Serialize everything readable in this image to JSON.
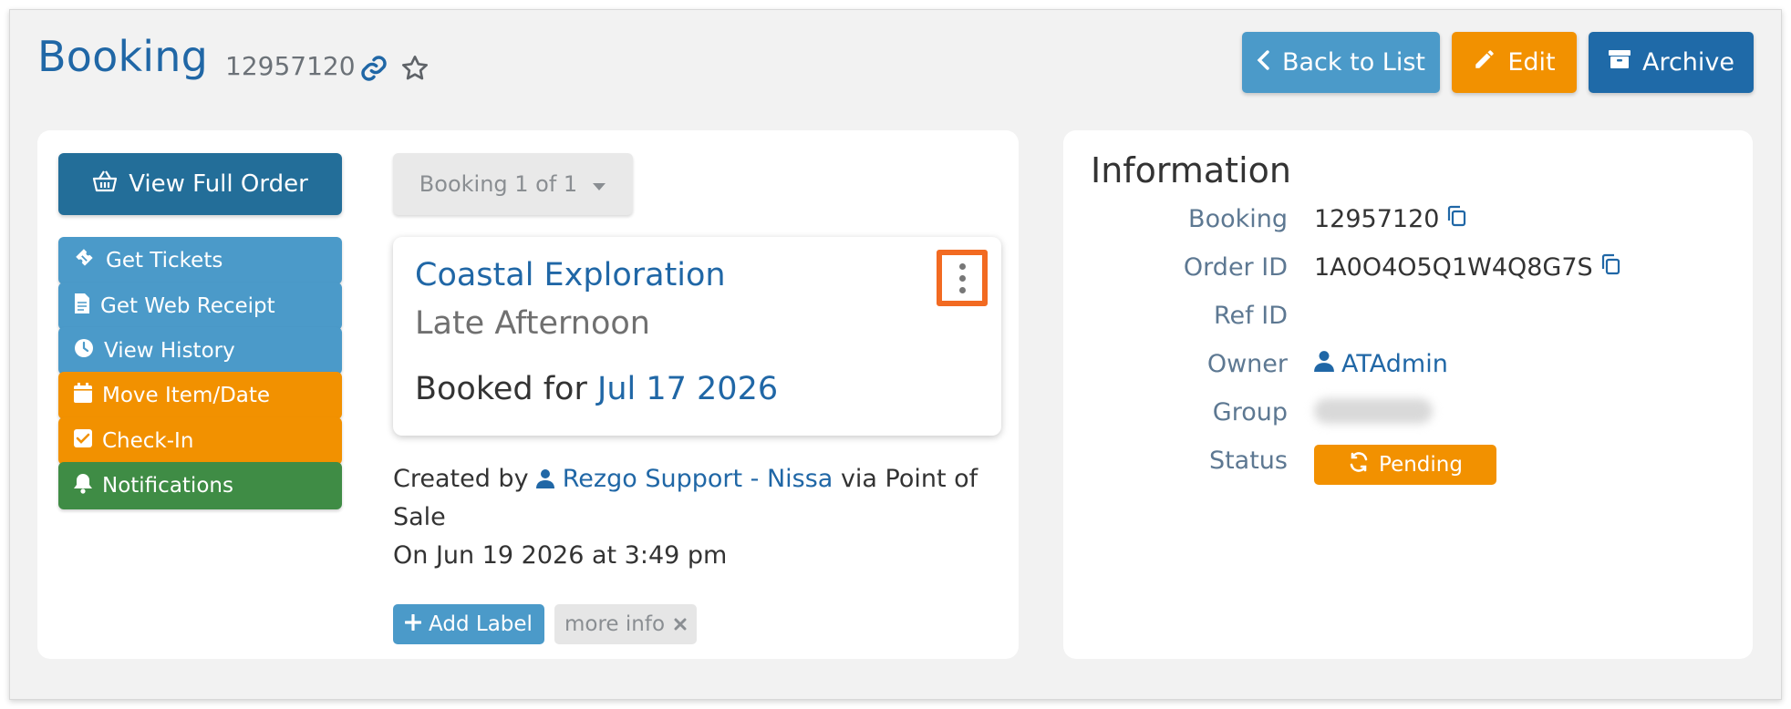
{
  "header": {
    "title": "Booking",
    "booking_number": "12957120",
    "back_label": "Back to List",
    "edit_label": "Edit",
    "archive_label": "Archive"
  },
  "actions": {
    "view_full_order": "View Full Order",
    "items": [
      {
        "label": "Get Tickets",
        "icon": "ticket-icon"
      },
      {
        "label": "Get Web Receipt",
        "icon": "document-icon"
      },
      {
        "label": "View History",
        "icon": "clock-icon"
      },
      {
        "label": "Move Item/Date",
        "icon": "calendar-icon"
      },
      {
        "label": "Check-In",
        "icon": "checkbox-icon"
      },
      {
        "label": "Notifications",
        "icon": "bell-icon"
      }
    ]
  },
  "booking_select": "Booking 1 of 1",
  "item": {
    "name": "Coastal Exploration",
    "time": "Late Afternoon",
    "booked_for_prefix": "Booked for",
    "booked_for_date": "Jul 17 2026"
  },
  "created": {
    "prefix": "Created by",
    "user": "Rezgo Support - Nissa",
    "via": "via Point of Sale",
    "on": "On Jun 19 2026 at 3:49 pm"
  },
  "labels": {
    "add_label": "Add Label",
    "more_info": "more info"
  },
  "information": {
    "title": "Information",
    "rows": [
      {
        "label": "Booking",
        "value": "12957120"
      },
      {
        "label": "Order ID",
        "value": "1A0O4O5Q1W4Q8G7S"
      },
      {
        "label": "Ref ID",
        "value": ""
      },
      {
        "label": "Owner",
        "value": "ATAdmin"
      },
      {
        "label": "Group",
        "value": ""
      },
      {
        "label": "Status",
        "value": "Pending"
      }
    ]
  },
  "colors": {
    "primary": "#2067a6",
    "accent_blue": "#4b9ac9",
    "accent_orange": "#f29100",
    "accent_green": "#3f8c45",
    "highlight": "#f26a21"
  }
}
